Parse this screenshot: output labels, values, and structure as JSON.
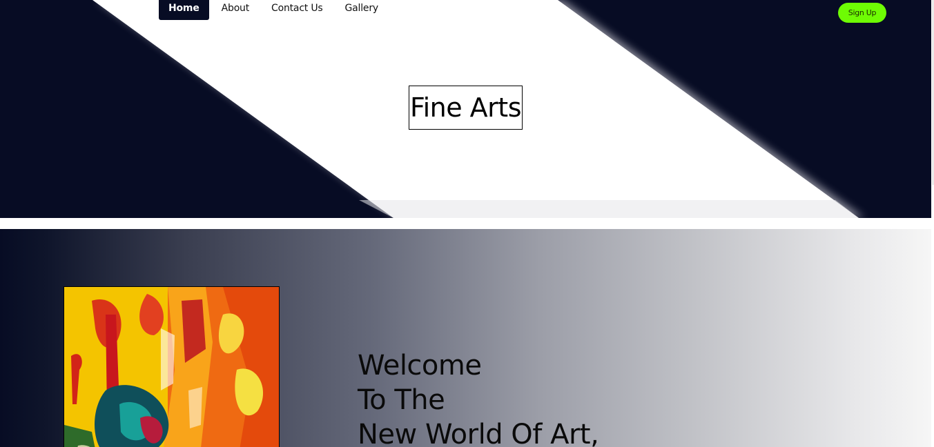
{
  "nav": {
    "items": [
      {
        "label": "Home",
        "active": true
      },
      {
        "label": "About",
        "active": false
      },
      {
        "label": "Contact Us",
        "active": false
      },
      {
        "label": "Gallery",
        "active": false
      }
    ]
  },
  "signup": {
    "label": "Sign Up",
    "color": "#6efc04"
  },
  "hero": {
    "title": "Fine Arts",
    "background": "#070c24"
  },
  "welcome": {
    "lines": [
      "Welcome",
      "To The",
      "New World Of Art,"
    ]
  },
  "images": {
    "painting": {
      "description_icon": "abstract-painting-image"
    }
  }
}
